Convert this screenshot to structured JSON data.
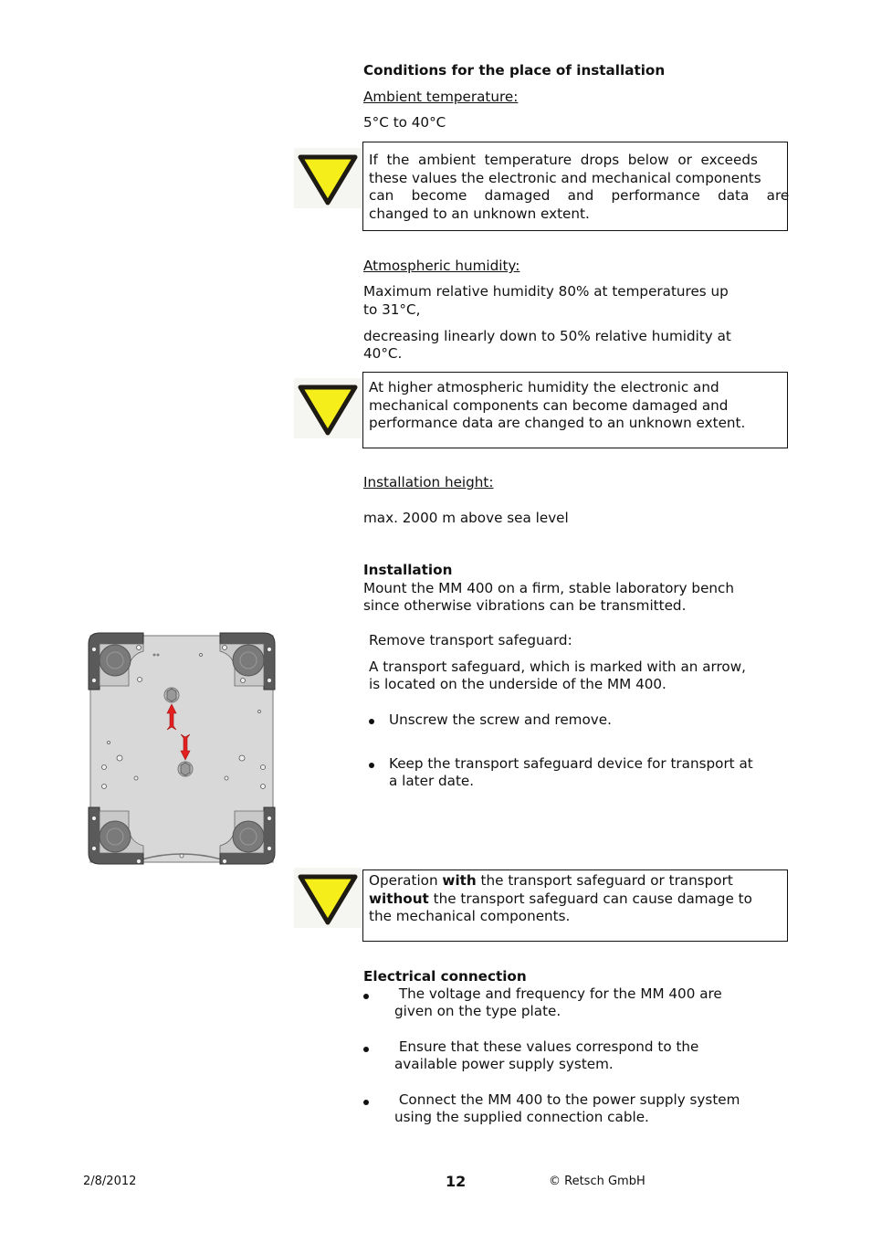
{
  "section_conditions": {
    "title": "Conditions for the place of installation",
    "ambient": {
      "label": "Ambient temperature:",
      "value": "5°C to 40°C",
      "warning_lines": [
        "If  the  ambient  temperature  drops  below  or  exceeds",
        "these values the electronic and mechanical components",
        "can    become    damaged    and    performance    data    are",
        "changed to an unknown extent."
      ]
    },
    "humidity": {
      "label": "Atmospheric humidity:",
      "line1a": "Maximum relative humidity 80% at temperatures up",
      "line1b": "to 31°C,",
      "line2a": "decreasing linearly down to 50% relative humidity at",
      "line2b": "40°C.",
      "warning_lines": [
        "At higher atmospheric humidity the electronic and",
        "mechanical components can become damaged and",
        "performance data are changed to an unknown extent."
      ]
    },
    "height": {
      "label": "Installation height:",
      "value": "max. 2000 m above sea level"
    }
  },
  "section_installation": {
    "title": "Installation",
    "line1": "Mount the MM 400 on a firm, stable laboratory bench",
    "line2": "since otherwise vibrations can be transmitted.",
    "remove_label": "Remove transport safeguard:",
    "desc1": "A transport safeguard, which is marked with an arrow,",
    "desc2": "is located on the underside of the MM 400.",
    "steps": [
      {
        "line1": "Unscrew the screw and remove.",
        "line2": ""
      },
      {
        "line1": "Keep the transport safeguard device for transport at",
        "line2": "a later date."
      }
    ],
    "warning": {
      "pre": "Operation ",
      "bold1": "with",
      "mid1": " the transport safeguard or transport",
      "bold2": "without",
      "mid2": " the transport safeguard can cause damage to",
      "line3": "the mechanical components."
    },
    "image_alt": "Underside of MM 400 with transport safeguard arrows"
  },
  "section_electrical": {
    "title": "Electrical connection",
    "items": [
      {
        "line1": " The voltage and frequency for the MM 400 are",
        "line2": "given on the type plate."
      },
      {
        "line1": " Ensure that these values correspond to the",
        "line2": "available power supply system."
      },
      {
        "line1": " Connect the MM 400 to the power supply system",
        "line2": "using the supplied connection cable."
      }
    ]
  },
  "footer": {
    "date": "2/8/2012",
    "page": "12",
    "copyright": "© Retsch GmbH"
  },
  "colors": {
    "warning_yellow": "#f5ee1a",
    "warning_border": "#1e1a14",
    "arrow_red": "#e41f1f"
  }
}
